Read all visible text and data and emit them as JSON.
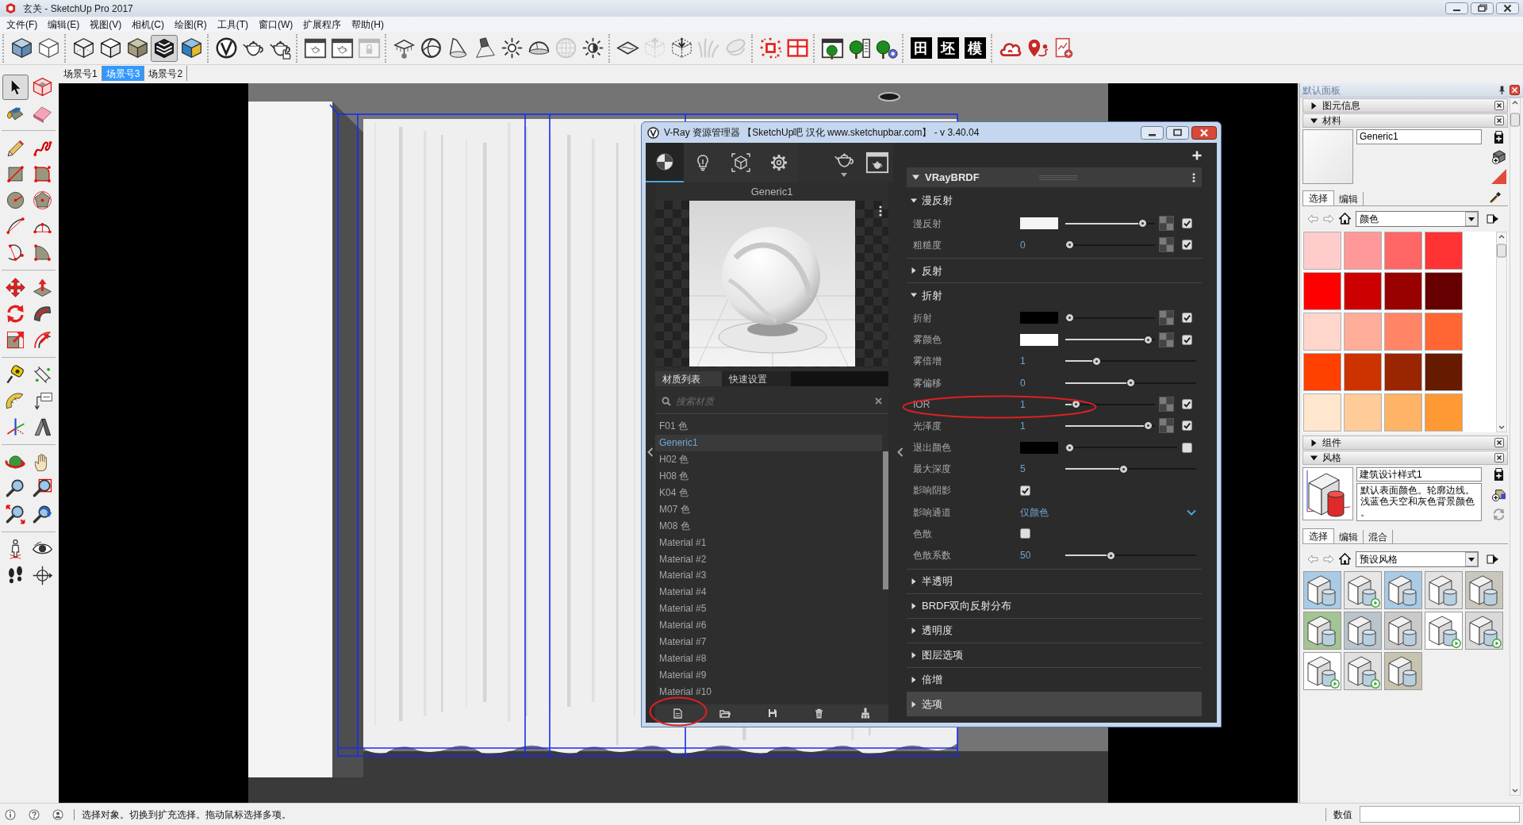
{
  "window": {
    "title": "玄关 - SketchUp Pro 2017"
  },
  "menu": [
    "文件(F)",
    "编辑(E)",
    "视图(V)",
    "相机(C)",
    "绘图(R)",
    "工具(T)",
    "窗口(W)",
    "扩展程序",
    "帮助(H)"
  ],
  "main_toolbar": [
    [
      {
        "kind": "icon",
        "selected": false,
        "disabled": false
      },
      {
        "kind": "icon",
        "selected": false,
        "disabled": false
      }
    ],
    [
      {
        "kind": "icon",
        "selected": false,
        "disabled": false
      },
      {
        "kind": "icon",
        "selected": false,
        "disabled": false
      },
      {
        "kind": "icon",
        "selected": false,
        "disabled": false
      },
      {
        "kind": "icon",
        "selected": true,
        "disabled": false
      },
      {
        "kind": "icon",
        "selected": false,
        "disabled": false
      }
    ],
    [
      {
        "kind": "icon",
        "selected": false,
        "disabled": false
      },
      {
        "kind": "icon",
        "selected": false,
        "disabled": false
      },
      {
        "kind": "icon",
        "selected": false,
        "disabled": false
      }
    ],
    [
      {
        "kind": "icon",
        "selected": false,
        "disabled": false
      },
      {
        "kind": "icon",
        "selected": false,
        "disabled": false
      },
      {
        "kind": "icon",
        "selected": false,
        "disabled": true
      }
    ],
    [
      {
        "kind": "icon",
        "selected": false,
        "disabled": false
      },
      {
        "kind": "icon",
        "selected": false,
        "disabled": false
      },
      {
        "kind": "icon",
        "selected": false,
        "disabled": false
      },
      {
        "kind": "icon",
        "selected": false,
        "disabled": false
      },
      {
        "kind": "icon",
        "selected": false,
        "disabled": false
      },
      {
        "kind": "icon",
        "selected": false,
        "disabled": false
      },
      {
        "kind": "icon",
        "selected": false,
        "disabled": true
      },
      {
        "kind": "icon",
        "selected": false,
        "disabled": false
      }
    ],
    [
      {
        "kind": "icon",
        "selected": false,
        "disabled": false
      },
      {
        "kind": "icon",
        "selected": false,
        "disabled": true
      },
      {
        "kind": "icon",
        "selected": false,
        "disabled": false
      },
      {
        "kind": "icon",
        "selected": false,
        "disabled": true
      },
      {
        "kind": "icon",
        "selected": false,
        "disabled": true
      }
    ],
    [
      {
        "kind": "icon",
        "selected": false,
        "disabled": false
      },
      {
        "kind": "icon",
        "selected": false,
        "disabled": false
      }
    ],
    [
      {
        "kind": "icon",
        "selected": false,
        "disabled": false
      },
      {
        "kind": "icon",
        "selected": false,
        "disabled": false
      },
      {
        "kind": "icon",
        "selected": false,
        "disabled": false
      }
    ],
    [
      {
        "kind": "glyph",
        "label": "田",
        "selected": false,
        "disabled": false
      },
      {
        "kind": "glyph",
        "label": "坯",
        "selected": false,
        "disabled": false
      },
      {
        "kind": "glyph",
        "label": "模",
        "selected": false,
        "disabled": false
      }
    ],
    [
      {
        "kind": "icon",
        "selected": false,
        "disabled": false
      },
      {
        "kind": "icon",
        "selected": false,
        "disabled": false
      },
      {
        "kind": "icon",
        "selected": false,
        "disabled": false
      }
    ]
  ],
  "scenes": [
    {
      "label": "场景号1",
      "selected": false
    },
    {
      "label": "场景号3",
      "selected": true
    },
    {
      "label": "场景号2",
      "selected": false
    }
  ],
  "tools": [
    [
      {
        "selected": true
      },
      {
        "selected": false
      },
      {
        "selected": false
      },
      {
        "selected": false
      }
    ],
    [
      {
        "selected": false
      },
      {
        "selected": false
      },
      {
        "selected": false
      },
      {
        "selected": false
      },
      {
        "selected": false
      },
      {
        "selected": false
      },
      {
        "selected": false
      },
      {
        "selected": false
      },
      {
        "selected": false
      },
      {
        "selected": false
      }
    ],
    [
      {
        "selected": false
      },
      {
        "selected": false
      },
      {
        "selected": false
      },
      {
        "selected": false
      },
      {
        "selected": false
      },
      {
        "selected": false
      }
    ],
    [
      {
        "selected": false
      },
      {
        "selected": false
      },
      {
        "selected": false
      },
      {
        "selected": false
      },
      {
        "selected": false
      },
      {
        "selected": false
      }
    ],
    [
      {
        "selected": false
      },
      {
        "selected": false
      },
      {
        "selected": false
      },
      {
        "selected": false
      },
      {
        "selected": false
      },
      {
        "selected": false
      }
    ],
    [
      {
        "selected": false
      },
      {
        "selected": false
      },
      {
        "selected": false
      },
      {
        "selected": false
      }
    ]
  ],
  "vray": {
    "title": "V-Ray 资源管理器 【SketchUp吧 汉化 www.sketchupbar.com】 - v 3.40.04",
    "asset_tabs": [
      {
        "selected": true
      },
      {
        "selected": false
      },
      {
        "selected": false
      },
      {
        "selected": false
      }
    ],
    "preview_title": "Generic1",
    "list_tabs": [
      {
        "label": "材质列表",
        "selected": true
      },
      {
        "label": "快速设置",
        "selected": false
      }
    ],
    "search_placeholder": "搜索材质",
    "materials": [
      {
        "label": "F01 色",
        "selected": false
      },
      {
        "label": "Generic1",
        "selected": true
      },
      {
        "label": "H02 色",
        "selected": false
      },
      {
        "label": "H08 色",
        "selected": false
      },
      {
        "label": "K04 色",
        "selected": false
      },
      {
        "label": "M07 色",
        "selected": false
      },
      {
        "label": "M08 色",
        "selected": false
      },
      {
        "label": "Material #1",
        "selected": false
      },
      {
        "label": "Material #2",
        "selected": false
      },
      {
        "label": "Material #3",
        "selected": false
      },
      {
        "label": "Material #4",
        "selected": false
      },
      {
        "label": "Material #5",
        "selected": false
      },
      {
        "label": "Material #6",
        "selected": false
      },
      {
        "label": "Material #7",
        "selected": false
      },
      {
        "label": "Material #8",
        "selected": false
      },
      {
        "label": "Material #9",
        "selected": false
      },
      {
        "label": "Material #10",
        "selected": false
      }
    ],
    "material_type": "VRayBRDF",
    "sections": [
      {
        "label": "漫反射",
        "expanded": true,
        "highlighted": false,
        "rows": [
          {
            "kind": "color",
            "label": "漫反射",
            "color": "#f4f4f4",
            "level": 0.9,
            "map": true,
            "checked": true
          },
          {
            "kind": "number",
            "label": "粗糙度",
            "value": "0",
            "level": 0,
            "map": true,
            "checked": true
          }
        ]
      },
      {
        "label": "反射",
        "expanded": false,
        "highlighted": false
      },
      {
        "label": "折射",
        "expanded": true,
        "highlighted": false,
        "rows": [
          {
            "kind": "color",
            "label": "折射",
            "color": "#000000",
            "level": 0,
            "map": true,
            "checked": true
          },
          {
            "kind": "color",
            "label": "雾颜色",
            "color": "#ffffff",
            "level": 0.97,
            "map": true,
            "checked": true
          },
          {
            "kind": "number",
            "label": "雾倍增",
            "value": "1",
            "level": 0.22,
            "map": false
          },
          {
            "kind": "number",
            "label": "雾偏移",
            "value": "0",
            "level": 0.5,
            "map": false
          },
          {
            "kind": "number",
            "label": "IOR",
            "value": "1",
            "level": 0.08,
            "map": true,
            "checked": true
          },
          {
            "kind": "number",
            "label": "光泽度",
            "value": "1",
            "level": 0.97,
            "map": true,
            "checked": true
          },
          {
            "kind": "color",
            "label": "退出颜色",
            "color": "#000000",
            "level": 0,
            "map": false,
            "checked": false
          },
          {
            "kind": "number",
            "label": "最大深度",
            "value": "5",
            "level": 0.44,
            "map": false
          },
          {
            "kind": "toggle",
            "label": "影响阴影",
            "checked": true
          },
          {
            "kind": "choice",
            "label": "影响通道",
            "value": "仅颜色"
          },
          {
            "kind": "toggle",
            "label": "色散",
            "checked": false
          },
          {
            "kind": "number",
            "label": "色散系数",
            "value": "50",
            "level": 0.34,
            "map": false
          }
        ]
      },
      {
        "label": "半透明",
        "expanded": false,
        "highlighted": false
      },
      {
        "label": "BRDF双向反射分布",
        "expanded": false,
        "highlighted": false
      },
      {
        "label": "透明度",
        "expanded": false,
        "highlighted": false
      },
      {
        "label": "图层选项",
        "expanded": false,
        "highlighted": false
      },
      {
        "label": "倍增",
        "expanded": false,
        "highlighted": false
      },
      {
        "label": "选项",
        "expanded": false,
        "highlighted": true
      }
    ]
  },
  "tray": {
    "title": "默认面板",
    "panels": [
      {
        "title": "图元信息",
        "expanded": false
      },
      {
        "kind": "materials",
        "title": "材料",
        "expanded": true,
        "name": "Generic1",
        "tabs": [
          {
            "label": "选择",
            "selected": true
          },
          {
            "label": "编辑",
            "selected": false
          }
        ],
        "library": "颜色",
        "swatches": [
          {
            "color": "#ffcccc"
          },
          {
            "color": "#ff9999"
          },
          {
            "color": "#ff6666"
          },
          {
            "color": "#ff3333"
          },
          {
            "color": "#ff0000"
          },
          {
            "color": "#cc0000"
          },
          {
            "color": "#990000"
          },
          {
            "color": "#660000"
          },
          {
            "color": "#ffd6cc"
          },
          {
            "color": "#ffad99"
          },
          {
            "color": "#ff8566"
          },
          {
            "color": "#ff6633"
          },
          {
            "color": "#ff4000"
          },
          {
            "color": "#cc3300"
          },
          {
            "color": "#992600"
          },
          {
            "color": "#661a00"
          },
          {
            "color": "#ffe6cc"
          },
          {
            "color": "#ffcc99"
          },
          {
            "color": "#ffb366"
          },
          {
            "color": "#ff9933"
          }
        ]
      },
      {
        "title": "组件",
        "expanded": false
      },
      {
        "kind": "styles",
        "title": "风格",
        "expanded": true,
        "name": "建筑设计样式1",
        "description": "默认表面颜色。轮廓边线。浅蓝色天空和灰色背景颜色。",
        "tabs": [
          {
            "label": "选择",
            "selected": true
          },
          {
            "label": "编辑",
            "selected": false
          },
          {
            "label": "混合",
            "selected": false
          }
        ],
        "library": "预设风格",
        "styles": [
          {
            "color": "#a9cbe6",
            "badge": false
          },
          {
            "color": "#e6e6e6",
            "badge": true
          },
          {
            "color": "#a9cbe6",
            "badge": false
          },
          {
            "color": "#e2e2e2",
            "badge": false
          },
          {
            "color": "#c9c7bc",
            "badge": false
          },
          {
            "color": "#a3c493",
            "badge": false
          },
          {
            "color": "#b9c4cb",
            "badge": false
          },
          {
            "color": "#cacaca",
            "badge": false
          },
          {
            "color": "#ffffff",
            "badge": true
          },
          {
            "color": "#d9d9d9",
            "badge": true
          },
          {
            "color": "#ffffff",
            "badge": true
          },
          {
            "color": "#e0e0e0",
            "badge": true
          },
          {
            "color": "#c6c3b1",
            "badge": false
          }
        ]
      }
    ]
  },
  "status_bar": {
    "hint": "选择对象。切换到扩充选择。拖动鼠标选择多项。",
    "measurement_label": "数值"
  }
}
